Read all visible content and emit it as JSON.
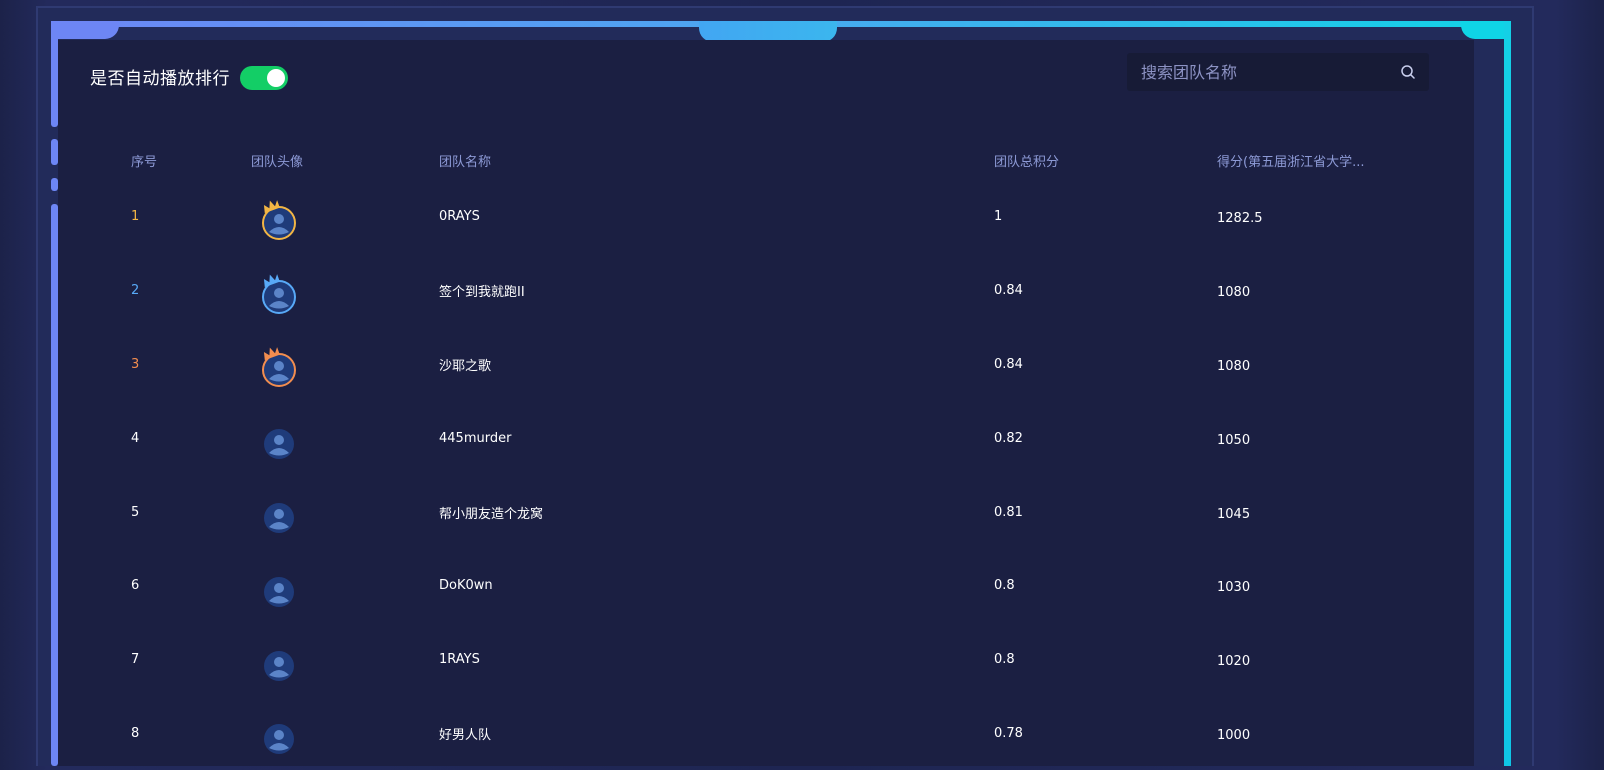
{
  "toolbar": {
    "autoplay_label": "是否自动播放排行",
    "autoplay_on": true
  },
  "search": {
    "placeholder": "搜索团队名称",
    "value": ""
  },
  "table": {
    "headers": [
      "序号",
      "团队头像",
      "团队名称",
      "团队总积分",
      "得分(第五届浙江省大学..."
    ],
    "rows": [
      {
        "rank": "1",
        "name": "0RAYS",
        "total": "1",
        "score": "1282.5",
        "medal": "gold"
      },
      {
        "rank": "2",
        "name": "签个到我就跑II",
        "total": "0.84",
        "score": "1080",
        "medal": "silver"
      },
      {
        "rank": "3",
        "name": "沙耶之歌",
        "total": "0.84",
        "score": "1080",
        "medal": "bronze"
      },
      {
        "rank": "4",
        "name": "445murder",
        "total": "0.82",
        "score": "1050",
        "medal": ""
      },
      {
        "rank": "5",
        "name": "帮小朋友造个龙窝",
        "total": "0.81",
        "score": "1045",
        "medal": ""
      },
      {
        "rank": "6",
        "name": "DoK0wn",
        "total": "0.8",
        "score": "1030",
        "medal": ""
      },
      {
        "rank": "7",
        "name": "1RAYS",
        "total": "0.8",
        "score": "1020",
        "medal": ""
      },
      {
        "rank": "8",
        "name": "好男人队",
        "total": "0.78",
        "score": "1000",
        "medal": ""
      }
    ]
  },
  "colors": {
    "gold": "#f2b544",
    "silver": "#58a9f7",
    "bronze": "#f28d4f",
    "toggle_on": "#13ce66",
    "frame_left": "#6d86f5",
    "frame_right": "#0fd4e6"
  },
  "icons": {
    "search": "search-icon",
    "avatar": "user-avatar-icon",
    "crown": "crown-icon"
  }
}
